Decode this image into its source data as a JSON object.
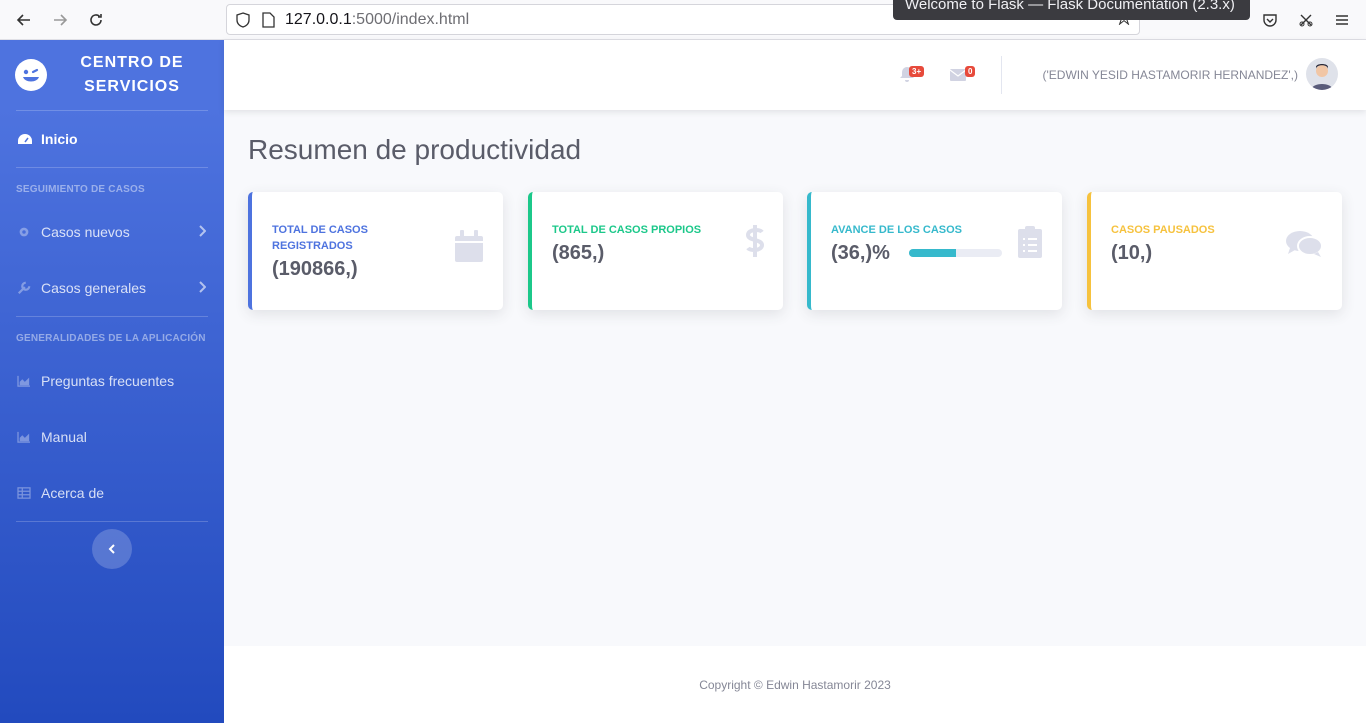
{
  "browser": {
    "url_host": "127.0.0.1",
    "url_path": ":5000/index.html",
    "tooltip": "Welcome to Flask — Flask Documentation (2.3.x)"
  },
  "sidebar": {
    "brand": "CENTRO DE SERVICIOS",
    "items": [
      {
        "label": "Inicio"
      },
      {
        "label": "Casos nuevos"
      },
      {
        "label": "Casos generales"
      },
      {
        "label": "Preguntas frecuentes"
      },
      {
        "label": "Manual"
      },
      {
        "label": "Acerca de"
      }
    ],
    "headings": [
      "SEGUIMIENTO DE CASOS",
      "GENERALIDADES DE LA APLICACIÓN"
    ]
  },
  "topbar": {
    "alerts_badge": "3+",
    "messages_badge": "0",
    "username": "('EDWIN YESID HASTAMORIR HERNANDEZ',)"
  },
  "main": {
    "title": "Resumen de productividad",
    "cards": [
      {
        "label": "TOTAL DE CASOS REGISTRADOS",
        "value": "(190866,)",
        "color": "#4e73df",
        "icon": "calendar-icon"
      },
      {
        "label": "TOTAL DE CASOS PROPIOS",
        "value": "(865,)",
        "color": "#1cc88a",
        "icon": "dollar-icon"
      },
      {
        "label": "AVANCE DE LOS CASOS",
        "value": "(36,)%",
        "color": "#36b9cc",
        "icon": "clipboard-icon",
        "progress": 0.5
      },
      {
        "label": "CASOS PAUSADOS",
        "value": "(10,)",
        "color": "#f6c23e",
        "icon": "comments-icon"
      }
    ]
  },
  "footer": {
    "copyright": "Copyright © Edwin Hastamorir 2023"
  }
}
